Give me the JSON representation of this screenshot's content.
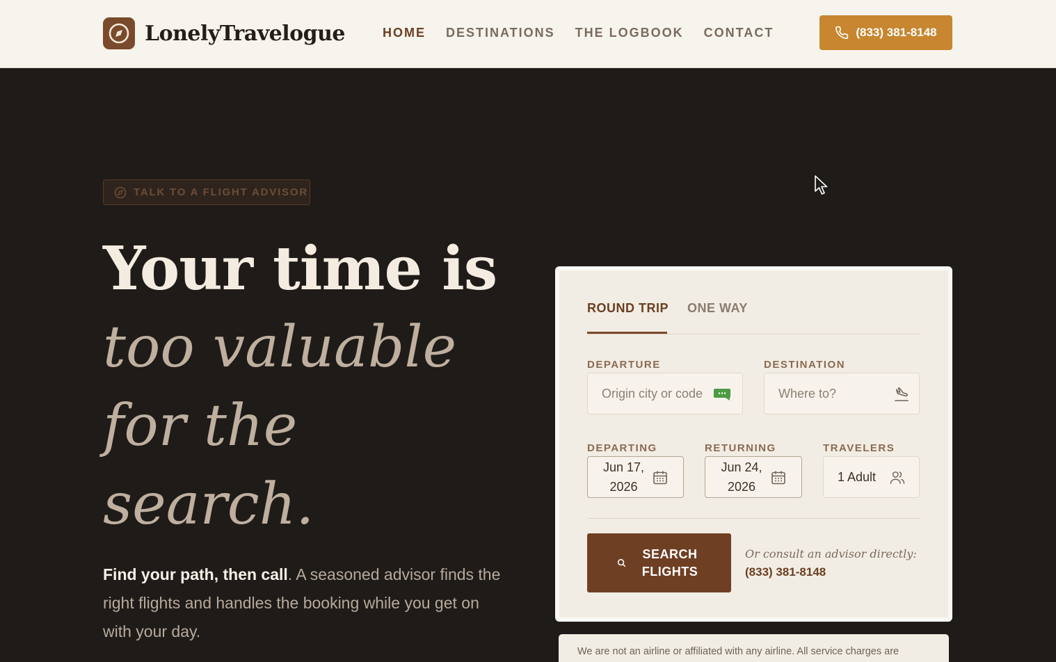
{
  "header": {
    "brand": "LonelyTravelogue",
    "nav": [
      {
        "label": "HOME",
        "active": true
      },
      {
        "label": "DESTINATIONS",
        "active": false
      },
      {
        "label": "THE LOGBOOK",
        "active": false
      },
      {
        "label": "CONTACT",
        "active": false
      }
    ],
    "phone_button": "(833) 381-8148"
  },
  "hero": {
    "badge": "TALK TO A FLIGHT ADVISOR",
    "headline_bold": "Your time is",
    "headline_italic": [
      "too valuable",
      "for the",
      "search."
    ],
    "sub_bold": "Find your path, then call",
    "sub_rest": ". A seasoned advisor finds the right flights and handles the booking while you get on with your day."
  },
  "search_card": {
    "tabs": [
      {
        "label": "ROUND TRIP",
        "active": true
      },
      {
        "label": "ONE WAY",
        "active": false
      }
    ],
    "departure": {
      "label": "DEPARTURE",
      "placeholder": "Origin city or code"
    },
    "destination": {
      "label": "DESTINATION",
      "placeholder": "Where to?"
    },
    "departing": {
      "label": "DEPARTING",
      "value_line1": "Jun 17,",
      "value_line2": "2026"
    },
    "returning": {
      "label": "RETURNING",
      "value_line1": "Jun 24,",
      "value_line2": "2026"
    },
    "travelers": {
      "label": "TRAVELERS",
      "value": "1 Adult"
    },
    "search_button_line1": "SEARCH",
    "search_button_line2": "FLIGHTS",
    "consult_text": "Or consult an advisor directly:",
    "consult_phone": "(833) 381-8148"
  },
  "disclaimer": "We are not an airline or affiliated with any airline. All service charges are",
  "colors": {
    "accent": "#c7862f",
    "brand_brown": "#6f3f24",
    "hero_bg": "#1f1b18",
    "header_bg": "#f7f4ee",
    "card_bg": "#f2ede4"
  },
  "icons": [
    "compass-logo-icon",
    "phone-icon",
    "compass-icon",
    "chat-bubble-icon",
    "plane-landing-icon",
    "calendar-icon",
    "users-icon",
    "search-icon",
    "cursor-pointer-icon"
  ]
}
